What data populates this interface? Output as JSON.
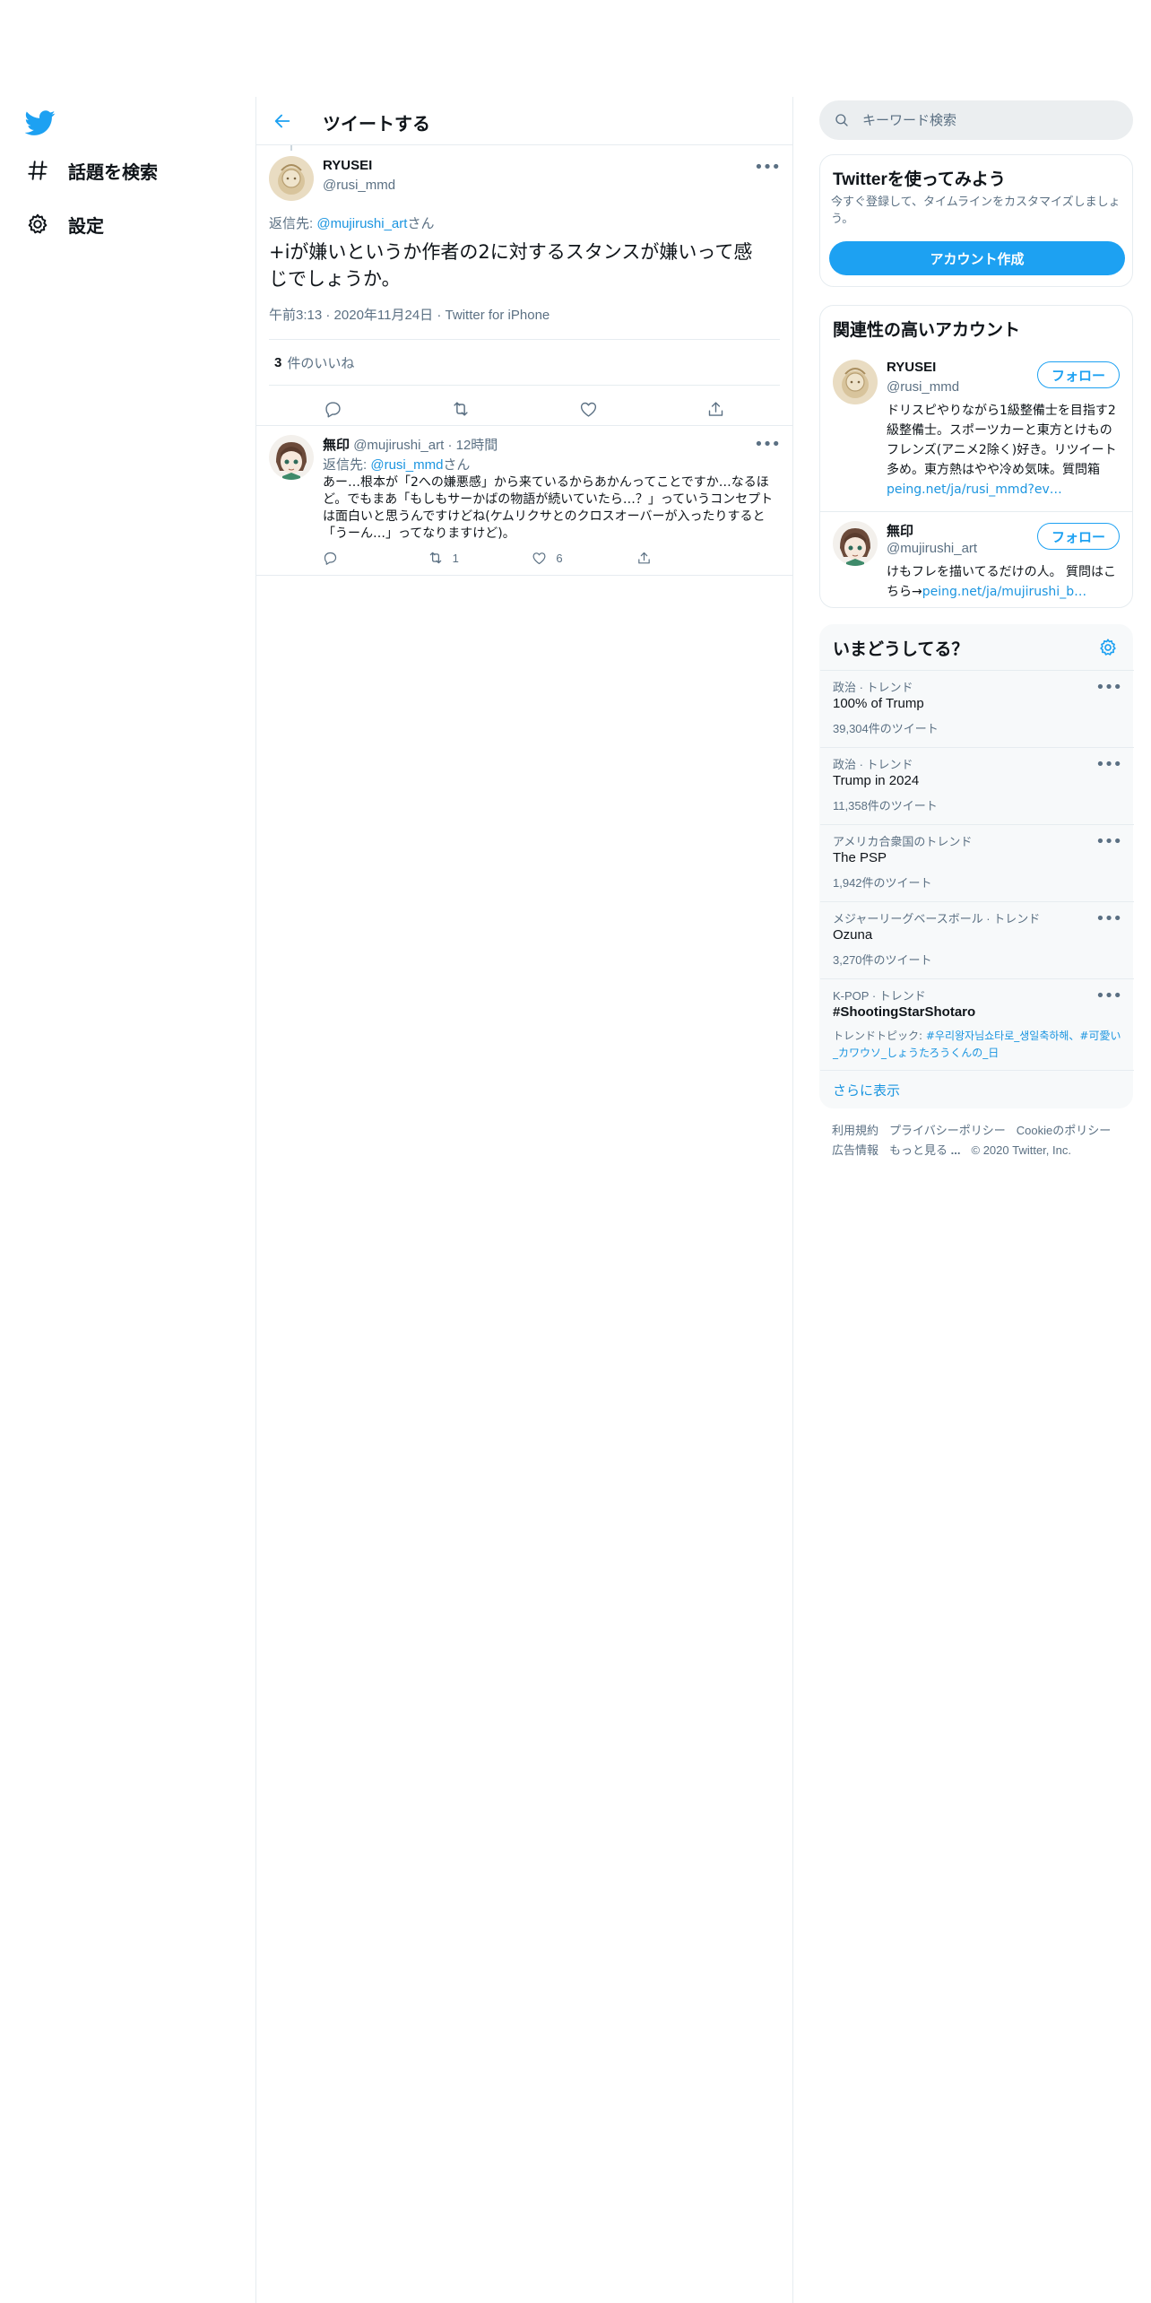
{
  "nav": {
    "items": [
      {
        "label": "話題を検索",
        "icon": "hashtag-icon"
      },
      {
        "label": "設定",
        "icon": "gear-icon"
      }
    ]
  },
  "header": {
    "title": "ツイートする"
  },
  "focus_tweet": {
    "author_name": "RYUSEI",
    "author_handle": "@rusi_mmd",
    "reply_to_prefix": "返信先: ",
    "reply_to_handle": "@mujirushi_art",
    "reply_to_suffix": "さん",
    "text": "+iが嫌いというか作者の2に対するスタンスが嫌いって感じでしょうか。",
    "time": "午前3:13",
    "date": "2020年11月24日",
    "source": "Twitter for iPhone",
    "likes_count": "3",
    "likes_label": "件のいいね"
  },
  "reply_tweet": {
    "author_name": "無印",
    "author_handle": "@mujirushi_art",
    "time_ago": "12時間",
    "reply_to_prefix": "返信先: ",
    "reply_to_handle": "@rusi_mmd",
    "reply_to_suffix": "さん",
    "text": "あー…根本が「2への嫌悪感」から来ているからあかんってことですか…なるほど。でもまあ「もしもサーかばの物語が続いていたら…？」っていうコンセプトは面白いと思うんですけどね(ケムリクサとのクロスオーバーが入ったりすると「うーん…」ってなりますけど)。",
    "retweets": "1",
    "likes": "6"
  },
  "search": {
    "placeholder": "キーワード検索"
  },
  "signup": {
    "title": "Twitterを使ってみよう",
    "description": "今すぐ登録して、タイムラインをカスタマイズしましょう。",
    "button": "アカウント作成"
  },
  "related": {
    "title": "関連性の高いアカウント",
    "follow_label": "フォロー",
    "accounts": [
      {
        "name": "RYUSEI",
        "handle": "@rusi_mmd",
        "bio": "ドリスピやりながら1級整備士を目指す2級整備士。スポーツカーと東方とけものフレンズ(アニメ2除く)好き。リツイート多め。東方熱はやや冷め気味。質問箱 ",
        "bio_link": "peing.net/ja/rusi_mmd?ev…"
      },
      {
        "name": "無印",
        "handle": "@mujirushi_art",
        "bio": "けもフレを描いてるだけの人。 質問はこちら→",
        "bio_link": "peing.net/ja/mujirushi_b…"
      }
    ]
  },
  "trends": {
    "title": "いまどうしてる？",
    "items": [
      {
        "context": "政治 · トレンド",
        "name": "100% of Trump",
        "count": "39,304件のツイート"
      },
      {
        "context": "政治 · トレンド",
        "name": "Trump in 2024",
        "count": "11,358件のツイート"
      },
      {
        "context": "アメリカ合衆国のトレンド",
        "name": "The PSP",
        "count": "1,942件のツイート"
      },
      {
        "context": "メジャーリーグベースボール · トレンド",
        "name": "Ozuna",
        "count": "3,270件のツイート"
      },
      {
        "context": "K-POP · トレンド",
        "name": "#ShootingStarShotaro",
        "topic_prefix": "トレンドトピック: ",
        "topic_links": "#우리왕자님쇼타로_생일축하해、#可愛い_カワウソ_しょうたろうくんの_日"
      }
    ],
    "show_more": "さらに表示"
  },
  "footer": {
    "links": [
      "利用規約",
      "プライバシーポリシー",
      "Cookieのポリシー",
      "広告情報",
      "もっと見る",
      "© 2020 Twitter, Inc."
    ],
    "more_dots": "..."
  },
  "colors": {
    "accent": "#1da1f2",
    "link": "#1b95e0",
    "secondary_text": "#5b7083",
    "border": "#e6ecf0"
  }
}
